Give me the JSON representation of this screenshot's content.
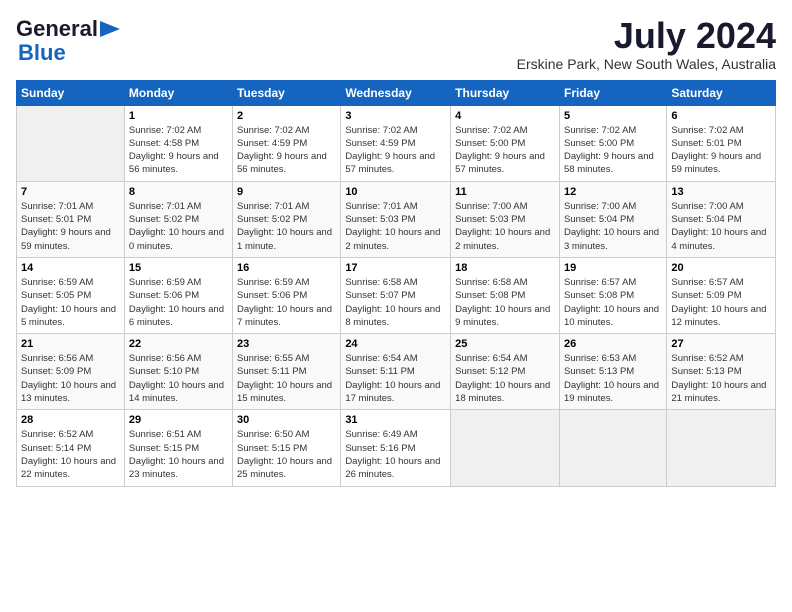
{
  "app": {
    "logo_general": "General",
    "logo_blue": "Blue",
    "month_title": "July 2024",
    "location": "Erskine Park, New South Wales, Australia"
  },
  "calendar": {
    "headers": [
      "Sunday",
      "Monday",
      "Tuesday",
      "Wednesday",
      "Thursday",
      "Friday",
      "Saturday"
    ],
    "weeks": [
      [
        {
          "day": "",
          "sunrise": "",
          "sunset": "",
          "daylight": ""
        },
        {
          "day": "1",
          "sunrise": "Sunrise: 7:02 AM",
          "sunset": "Sunset: 4:58 PM",
          "daylight": "Daylight: 9 hours and 56 minutes."
        },
        {
          "day": "2",
          "sunrise": "Sunrise: 7:02 AM",
          "sunset": "Sunset: 4:59 PM",
          "daylight": "Daylight: 9 hours and 56 minutes."
        },
        {
          "day": "3",
          "sunrise": "Sunrise: 7:02 AM",
          "sunset": "Sunset: 4:59 PM",
          "daylight": "Daylight: 9 hours and 57 minutes."
        },
        {
          "day": "4",
          "sunrise": "Sunrise: 7:02 AM",
          "sunset": "Sunset: 5:00 PM",
          "daylight": "Daylight: 9 hours and 57 minutes."
        },
        {
          "day": "5",
          "sunrise": "Sunrise: 7:02 AM",
          "sunset": "Sunset: 5:00 PM",
          "daylight": "Daylight: 9 hours and 58 minutes."
        },
        {
          "day": "6",
          "sunrise": "Sunrise: 7:02 AM",
          "sunset": "Sunset: 5:01 PM",
          "daylight": "Daylight: 9 hours and 59 minutes."
        }
      ],
      [
        {
          "day": "7",
          "sunrise": "Sunrise: 7:01 AM",
          "sunset": "Sunset: 5:01 PM",
          "daylight": "Daylight: 9 hours and 59 minutes."
        },
        {
          "day": "8",
          "sunrise": "Sunrise: 7:01 AM",
          "sunset": "Sunset: 5:02 PM",
          "daylight": "Daylight: 10 hours and 0 minutes."
        },
        {
          "day": "9",
          "sunrise": "Sunrise: 7:01 AM",
          "sunset": "Sunset: 5:02 PM",
          "daylight": "Daylight: 10 hours and 1 minute."
        },
        {
          "day": "10",
          "sunrise": "Sunrise: 7:01 AM",
          "sunset": "Sunset: 5:03 PM",
          "daylight": "Daylight: 10 hours and 2 minutes."
        },
        {
          "day": "11",
          "sunrise": "Sunrise: 7:00 AM",
          "sunset": "Sunset: 5:03 PM",
          "daylight": "Daylight: 10 hours and 2 minutes."
        },
        {
          "day": "12",
          "sunrise": "Sunrise: 7:00 AM",
          "sunset": "Sunset: 5:04 PM",
          "daylight": "Daylight: 10 hours and 3 minutes."
        },
        {
          "day": "13",
          "sunrise": "Sunrise: 7:00 AM",
          "sunset": "Sunset: 5:04 PM",
          "daylight": "Daylight: 10 hours and 4 minutes."
        }
      ],
      [
        {
          "day": "14",
          "sunrise": "Sunrise: 6:59 AM",
          "sunset": "Sunset: 5:05 PM",
          "daylight": "Daylight: 10 hours and 5 minutes."
        },
        {
          "day": "15",
          "sunrise": "Sunrise: 6:59 AM",
          "sunset": "Sunset: 5:06 PM",
          "daylight": "Daylight: 10 hours and 6 minutes."
        },
        {
          "day": "16",
          "sunrise": "Sunrise: 6:59 AM",
          "sunset": "Sunset: 5:06 PM",
          "daylight": "Daylight: 10 hours and 7 minutes."
        },
        {
          "day": "17",
          "sunrise": "Sunrise: 6:58 AM",
          "sunset": "Sunset: 5:07 PM",
          "daylight": "Daylight: 10 hours and 8 minutes."
        },
        {
          "day": "18",
          "sunrise": "Sunrise: 6:58 AM",
          "sunset": "Sunset: 5:08 PM",
          "daylight": "Daylight: 10 hours and 9 minutes."
        },
        {
          "day": "19",
          "sunrise": "Sunrise: 6:57 AM",
          "sunset": "Sunset: 5:08 PM",
          "daylight": "Daylight: 10 hours and 10 minutes."
        },
        {
          "day": "20",
          "sunrise": "Sunrise: 6:57 AM",
          "sunset": "Sunset: 5:09 PM",
          "daylight": "Daylight: 10 hours and 12 minutes."
        }
      ],
      [
        {
          "day": "21",
          "sunrise": "Sunrise: 6:56 AM",
          "sunset": "Sunset: 5:09 PM",
          "daylight": "Daylight: 10 hours and 13 minutes."
        },
        {
          "day": "22",
          "sunrise": "Sunrise: 6:56 AM",
          "sunset": "Sunset: 5:10 PM",
          "daylight": "Daylight: 10 hours and 14 minutes."
        },
        {
          "day": "23",
          "sunrise": "Sunrise: 6:55 AM",
          "sunset": "Sunset: 5:11 PM",
          "daylight": "Daylight: 10 hours and 15 minutes."
        },
        {
          "day": "24",
          "sunrise": "Sunrise: 6:54 AM",
          "sunset": "Sunset: 5:11 PM",
          "daylight": "Daylight: 10 hours and 17 minutes."
        },
        {
          "day": "25",
          "sunrise": "Sunrise: 6:54 AM",
          "sunset": "Sunset: 5:12 PM",
          "daylight": "Daylight: 10 hours and 18 minutes."
        },
        {
          "day": "26",
          "sunrise": "Sunrise: 6:53 AM",
          "sunset": "Sunset: 5:13 PM",
          "daylight": "Daylight: 10 hours and 19 minutes."
        },
        {
          "day": "27",
          "sunrise": "Sunrise: 6:52 AM",
          "sunset": "Sunset: 5:13 PM",
          "daylight": "Daylight: 10 hours and 21 minutes."
        }
      ],
      [
        {
          "day": "28",
          "sunrise": "Sunrise: 6:52 AM",
          "sunset": "Sunset: 5:14 PM",
          "daylight": "Daylight: 10 hours and 22 minutes."
        },
        {
          "day": "29",
          "sunrise": "Sunrise: 6:51 AM",
          "sunset": "Sunset: 5:15 PM",
          "daylight": "Daylight: 10 hours and 23 minutes."
        },
        {
          "day": "30",
          "sunrise": "Sunrise: 6:50 AM",
          "sunset": "Sunset: 5:15 PM",
          "daylight": "Daylight: 10 hours and 25 minutes."
        },
        {
          "day": "31",
          "sunrise": "Sunrise: 6:49 AM",
          "sunset": "Sunset: 5:16 PM",
          "daylight": "Daylight: 10 hours and 26 minutes."
        },
        {
          "day": "",
          "sunrise": "",
          "sunset": "",
          "daylight": ""
        },
        {
          "day": "",
          "sunrise": "",
          "sunset": "",
          "daylight": ""
        },
        {
          "day": "",
          "sunrise": "",
          "sunset": "",
          "daylight": ""
        }
      ]
    ]
  }
}
